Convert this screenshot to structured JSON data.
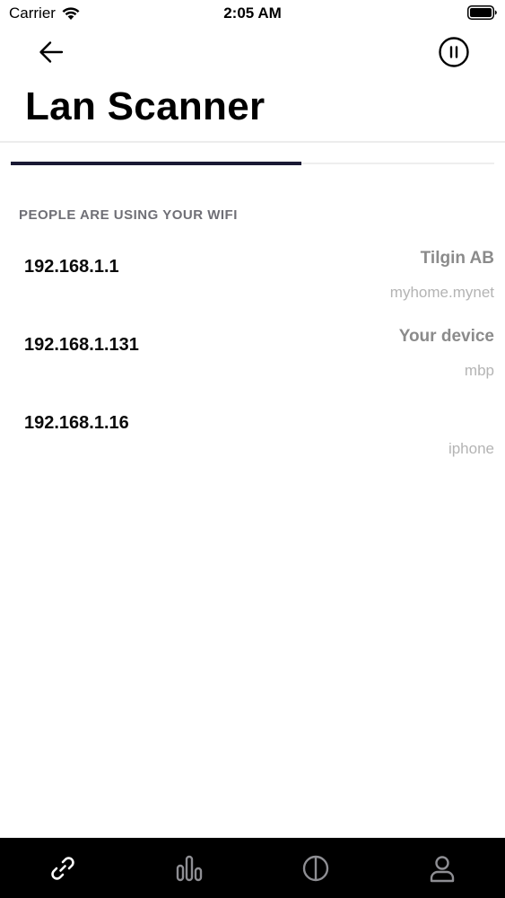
{
  "status_bar": {
    "carrier": "Carrier",
    "time": "2:05 AM"
  },
  "header": {
    "back_icon": "arrow-left-icon",
    "pause_icon": "pause-circle-icon",
    "title": "Lan Scanner"
  },
  "section": {
    "title": "PEOPLE ARE USING YOUR WIFI"
  },
  "devices": [
    {
      "ip": "192.168.1.1",
      "name": "Tilgin AB",
      "host": "myhome.mynet"
    },
    {
      "ip": "192.168.1.131",
      "name": "Your device",
      "host": "mbp"
    },
    {
      "ip": "192.168.1.16",
      "name": "",
      "host": "iphone"
    }
  ],
  "tab_bar": {
    "items": [
      {
        "icon": "link-icon",
        "active": true
      },
      {
        "icon": "bar-chart-icon",
        "active": false
      },
      {
        "icon": "half-circle-icon",
        "active": false
      },
      {
        "icon": "user-icon",
        "active": false
      }
    ]
  },
  "colors": {
    "accent": "#1a1934",
    "tab_bar_background": "#000000",
    "section_header": "#6f6f76",
    "secondary_text": "#8b8b8b",
    "tertiary_text": "#b4b4b4"
  }
}
